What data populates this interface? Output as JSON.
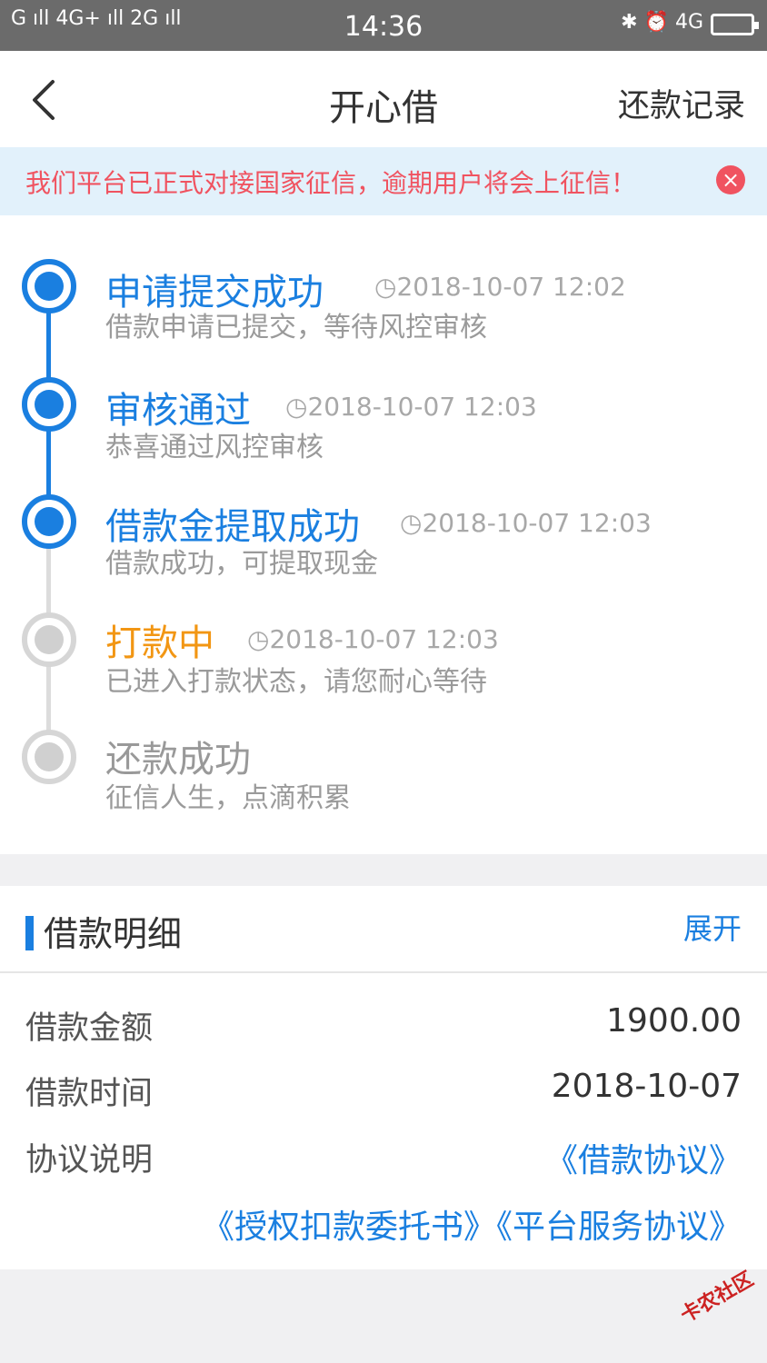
{
  "status": {
    "left": "G ıll 4G+ ıll 2G ıll",
    "time": "14:36",
    "right": "✱ ⏰ 4G"
  },
  "header": {
    "title": "开心借",
    "right_link": "还款记录"
  },
  "notice": {
    "text": "我们平台已正式对接国家征信，逾期用户将会上征信！",
    "close_icon": "close-icon"
  },
  "timeline": [
    {
      "title": "申请提交成功",
      "time": "2018-10-07 12:02",
      "desc": "借款申请已提交，等待风控审核",
      "status": "done"
    },
    {
      "title": "审核通过",
      "time": "2018-10-07 12:03",
      "desc": "恭喜通过风控审核",
      "status": "done"
    },
    {
      "title": "借款金提取成功",
      "time": "2018-10-07 12:03",
      "desc": "借款成功，可提取现金",
      "status": "done"
    },
    {
      "title": "打款中",
      "time": "2018-10-07 12:03",
      "desc": "已进入打款状态，请您耐心等待",
      "status": "current"
    },
    {
      "title": "还款成功",
      "time": "",
      "desc": "征信人生，点滴积累",
      "status": "pending"
    }
  ],
  "detail": {
    "title": "借款明细",
    "expand": "展开",
    "rows": [
      {
        "label": "借款金额",
        "value": "1900.00"
      },
      {
        "label": "借款时间",
        "value": "2018-10-07"
      },
      {
        "label": "协议说明",
        "value": "《借款协议》"
      }
    ],
    "links": [
      "《授权扣款委托书》",
      "《平台服务协议》"
    ]
  },
  "watermark": "卡农社区",
  "colors": {
    "primary": "#1a7fe0",
    "warning": "#f29613",
    "alert": "#f05360"
  }
}
